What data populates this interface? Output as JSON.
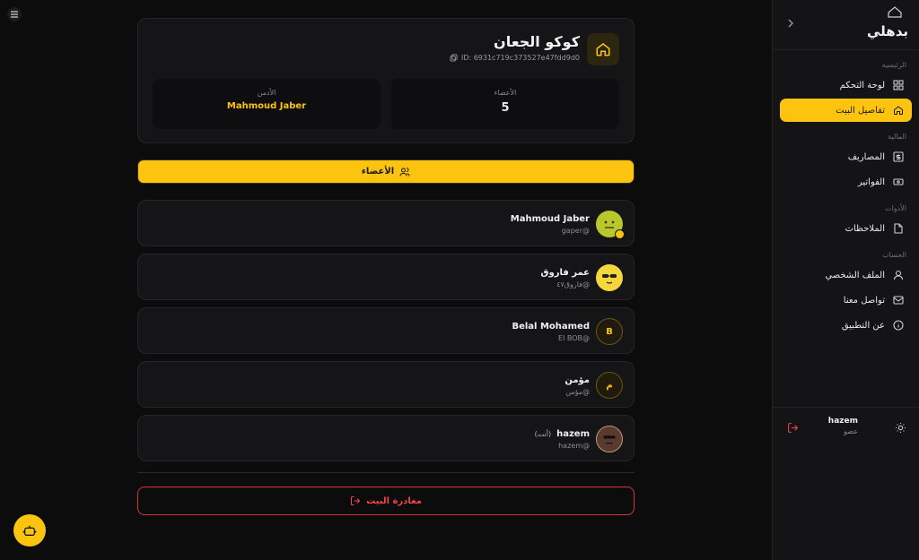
{
  "app": {
    "logo_text": "بدهلي"
  },
  "sidebar": {
    "sections": [
      {
        "label": "الرئيسية",
        "items": [
          {
            "label": "لوحة التحكم",
            "icon": "grid-icon",
            "active": false
          },
          {
            "label": "تفاصيل البيت",
            "icon": "home-icon",
            "active": true
          }
        ]
      },
      {
        "label": "المالية",
        "items": [
          {
            "label": "المصاريف",
            "icon": "dollar-icon",
            "active": false
          },
          {
            "label": "الفواتير",
            "icon": "bill-icon",
            "active": false
          }
        ]
      },
      {
        "label": "الأدوات",
        "items": [
          {
            "label": "الملاحظات",
            "icon": "note-icon",
            "active": false
          }
        ]
      },
      {
        "label": "الحساب",
        "items": [
          {
            "label": "الملف الشخصي",
            "icon": "user-icon",
            "active": false
          },
          {
            "label": "تواصل معنا",
            "icon": "mail-icon",
            "active": false
          },
          {
            "label": "عن التطبيق",
            "icon": "info-icon",
            "active": false
          }
        ]
      }
    ],
    "user": {
      "name": "hazem",
      "role": "عضو"
    }
  },
  "house": {
    "name": "كوكو الجعان",
    "id_text": "ID: 6931c719c373527e47fdd9d0",
    "members_label": "الأعضاء",
    "members_count": "5",
    "admin_label": "الأدمن",
    "admin_name": "Mahmoud Jaber"
  },
  "members_tab_label": "الأعضاء",
  "members": [
    {
      "name": "Mahmoud Jaber",
      "username": "@gaper",
      "avatar_type": "emoji-lime",
      "is_admin": true,
      "you": ""
    },
    {
      "name": "عمر فاروق",
      "username": "@فاروق٤٧",
      "avatar_type": "emoji-sun",
      "is_admin": false,
      "you": ""
    },
    {
      "name": "Belal Mohamed",
      "username": "@El BOB",
      "avatar_type": "letter",
      "letter": "B",
      "is_admin": false,
      "you": ""
    },
    {
      "name": "مؤمن",
      "username": "@مؤمن",
      "avatar_type": "letter",
      "letter": "م",
      "is_admin": false,
      "you": ""
    },
    {
      "name": "hazem",
      "username": "@hazem",
      "avatar_type": "emoji-brown",
      "is_admin": false,
      "you": "(أنت)"
    }
  ],
  "leave_label": "مغادرة البيت",
  "colors": {
    "accent": "#fcc40f",
    "danger": "#e8474a",
    "bg": "#0c0c0d",
    "card": "#151517"
  }
}
